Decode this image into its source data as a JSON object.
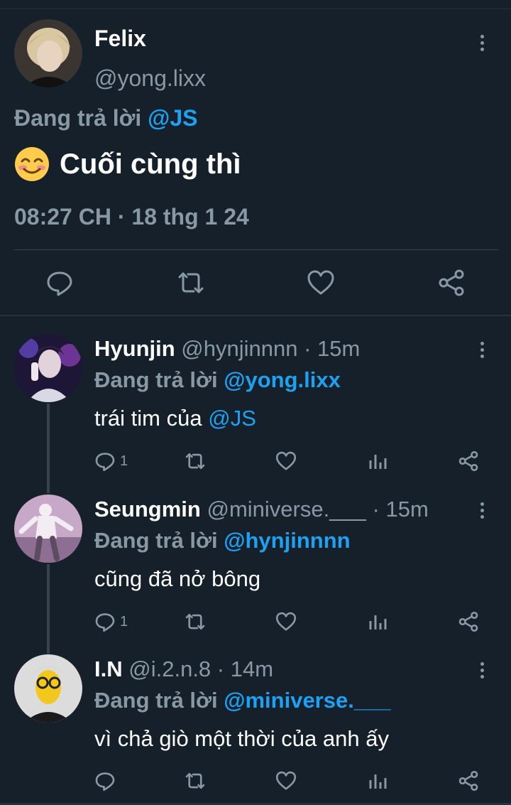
{
  "main_tweet": {
    "name": "Felix",
    "handle": "@yong.lixx",
    "replying_prefix": "Đang trả lời",
    "replying_to": "@JS",
    "text": "Cuối cùng thì",
    "emoji_icon": "smiling-face-icon",
    "timestamp": "08:27 CH · 18 thg 1 24",
    "actions": [
      "reply-icon",
      "retweet-icon",
      "like-icon",
      "share-icon"
    ]
  },
  "replies": [
    {
      "name": "Hyunjin",
      "handle": "@hynjinnnn · 15m",
      "replying_prefix": "Đang trả lời",
      "replying_to": "@yong.lixx",
      "text": "trái tim của ",
      "text_mention": "@JS",
      "reply_count": "1"
    },
    {
      "name": "Seungmin",
      "handle": "@miniverse.___ · 15m",
      "replying_prefix": "Đang trả lời",
      "replying_to": "@hynjinnnn",
      "text": "cũng đã nở bông",
      "reply_count": "1"
    },
    {
      "name": "I.N",
      "handle": "@i.2.n.8 · 14m",
      "replying_prefix": "Đang trả lời",
      "replying_to": "@miniverse.___",
      "text": "vì chả giò một thời của anh ấy",
      "reply_count": ""
    }
  ],
  "colors": {
    "background": "#15202b",
    "secondary_text": "#8899a6",
    "link": "#1da1f2",
    "divider": "#38444d"
  }
}
